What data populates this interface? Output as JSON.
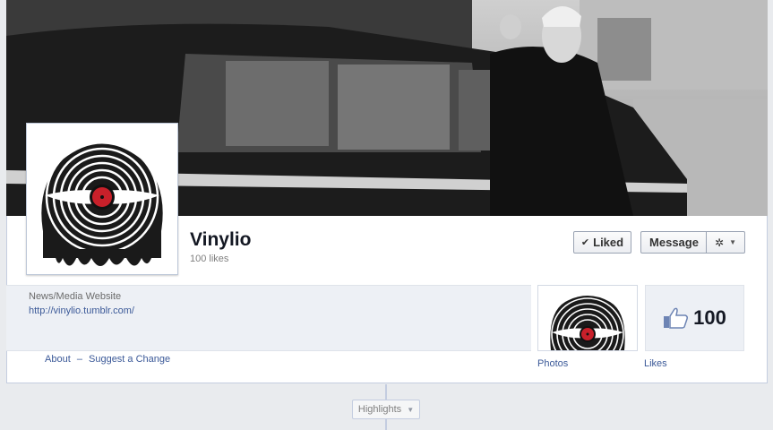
{
  "page": {
    "name": "Vinylio",
    "likes_text": "100 likes",
    "category": "News/Media Website",
    "website": "http://vinylio.tumblr.com/"
  },
  "actions": {
    "liked_label": "Liked",
    "message_label": "Message"
  },
  "about_links": {
    "about": "About",
    "separator": "–",
    "suggest": "Suggest a Change"
  },
  "apps": {
    "photos_label": "Photos",
    "likes_label": "Likes",
    "likes_count": "100"
  },
  "timeline": {
    "highlights_label": "Highlights"
  },
  "icons": {
    "check": "check-icon",
    "gear": "gear-icon",
    "caret": "caret-down-icon",
    "thumb": "thumbs-up-icon"
  },
  "colors": {
    "link": "#3b5998",
    "background": "#e9ebee"
  }
}
